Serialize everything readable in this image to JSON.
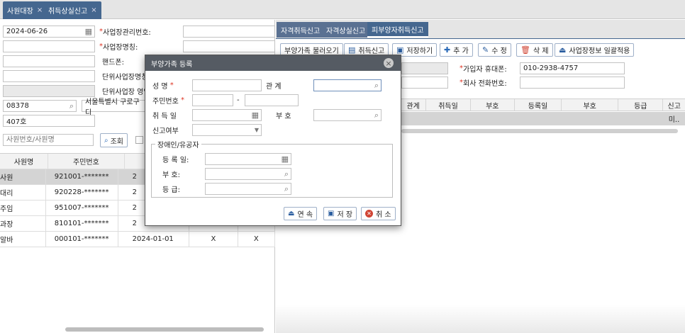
{
  "top_tabs": [
    {
      "label": "사원대장"
    },
    {
      "label": "취득상실신고"
    }
  ],
  "left": {
    "date": "2024-06-26",
    "labels": {
      "biz_mgmt_no": "사업장관리번호:",
      "biz_name": "사업장명칭:",
      "phone": "핸드폰:",
      "unit_biz_name": "단위사업장명칭:",
      "unit_biz_op": "단위사업장 영업"
    },
    "zip": "08378",
    "address": "서울특별시 구로구 디",
    "address_detail": "407호",
    "search_placeholder": "사원번호/사원명",
    "search_btn": "조회",
    "table": {
      "headers": [
        "사원명",
        "주민번호",
        "",
        "",
        ""
      ],
      "rows": [
        {
          "name": "사원",
          "rrn": "921001-*******",
          "date": "2",
          "a": "",
          "b": ""
        },
        {
          "name": "대리",
          "rrn": "920228-*******",
          "date": "2",
          "a": "",
          "b": ""
        },
        {
          "name": "주임",
          "rrn": "951007-*******",
          "date": "2",
          "a": "",
          "b": ""
        },
        {
          "name": "과장",
          "rrn": "810101-*******",
          "date": "2",
          "a": "",
          "b": ""
        },
        {
          "name": "알바",
          "rrn": "000101-*******",
          "date": "2024-01-01",
          "a": "X",
          "b": "X"
        }
      ]
    }
  },
  "right": {
    "tabs": [
      {
        "label": "자격취득신고"
      },
      {
        "label": "자격상실신고"
      },
      {
        "label": "피부양자취득신고"
      }
    ],
    "toolbar": {
      "load_dependents": "부양가족 불러오기",
      "acquire_report": "취득신고",
      "save_as": "저장하기",
      "add": "추 가",
      "edit": "수 정",
      "delete": "삭 제",
      "apply_biz": "사업장정보 일괄적용"
    },
    "subscriber_phone_label": "가입자 휴대폰:",
    "subscriber_phone": "010-2938-4757",
    "company_phone_label": "회사 전화번호:",
    "grid_headers": [
      "관계",
      "취득일",
      "부호",
      "등록일",
      "부호",
      "등급",
      "신고"
    ],
    "grid_row_last": "미.."
  },
  "modal": {
    "title": "부양가족 등록",
    "labels": {
      "name": "성 명",
      "relation": "관 계",
      "rrn": "주민번호",
      "acquired": "취 득 일",
      "code": "부 호",
      "report_status": "신고여부",
      "group": "장애인/유공자",
      "reg_date": "등 록 일:",
      "code2": "부 호:",
      "grade": "등 급:"
    },
    "rrn_separator": "-",
    "buttons": {
      "continue": "연 속",
      "save": "저 장",
      "cancel": "취 소"
    }
  }
}
